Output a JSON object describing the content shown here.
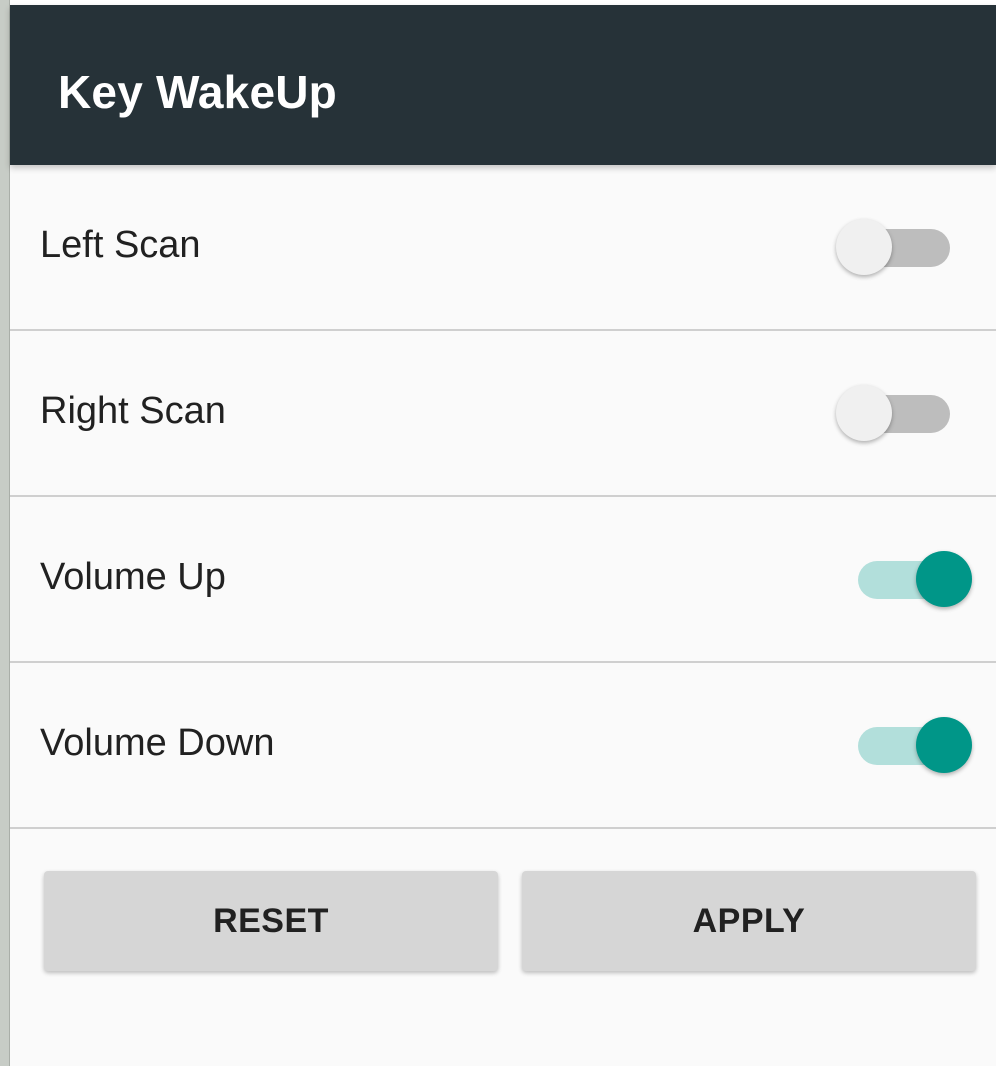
{
  "toolbar": {
    "title": "Key WakeUp",
    "background_color": "#263238"
  },
  "settings": [
    {
      "label": "Left Scan",
      "enabled": false
    },
    {
      "label": "Right Scan",
      "enabled": false
    },
    {
      "label": "Volume Up",
      "enabled": true
    },
    {
      "label": "Volume Down",
      "enabled": true
    }
  ],
  "actions": {
    "reset_label": "RESET",
    "apply_label": "APPLY"
  },
  "colors": {
    "accent": "#009688",
    "accent_track": "#b2dfdb",
    "switch_off_track": "#bdbdbd",
    "switch_off_thumb": "#f0f0f0",
    "button_background": "#d6d6d6"
  }
}
